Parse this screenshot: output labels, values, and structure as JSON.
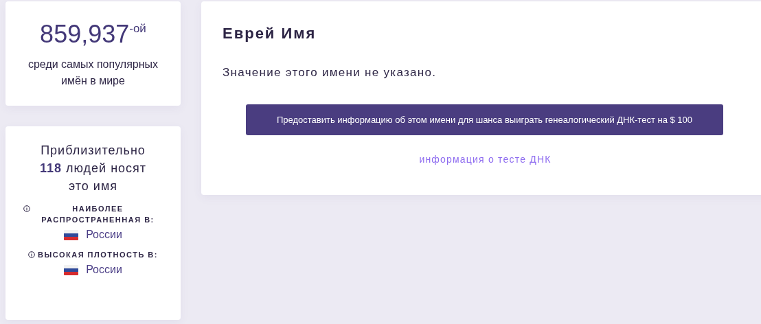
{
  "rank_card": {
    "rank": "859,937",
    "suffix": "-ой",
    "caption": "среди самых популярных имён в мире"
  },
  "count_card": {
    "text": "Приблизительно **118** людей носят это имя",
    "sections": [
      {
        "label": "НАИБОЛЕЕ РАСПРОСТРАНЕННАЯ В:",
        "country": "России"
      },
      {
        "label": "ВЫСОКАЯ ПЛОТНОСТЬ В:",
        "country": "России"
      }
    ]
  },
  "main": {
    "title": "Еврей Имя",
    "meaning": "Значение этого имени не указано.",
    "button": "Предоставить информацию об этом имени для шанса выиграть генеалогический ДНК-тест на $ 100",
    "link": "информация о тесте ДНК"
  }
}
